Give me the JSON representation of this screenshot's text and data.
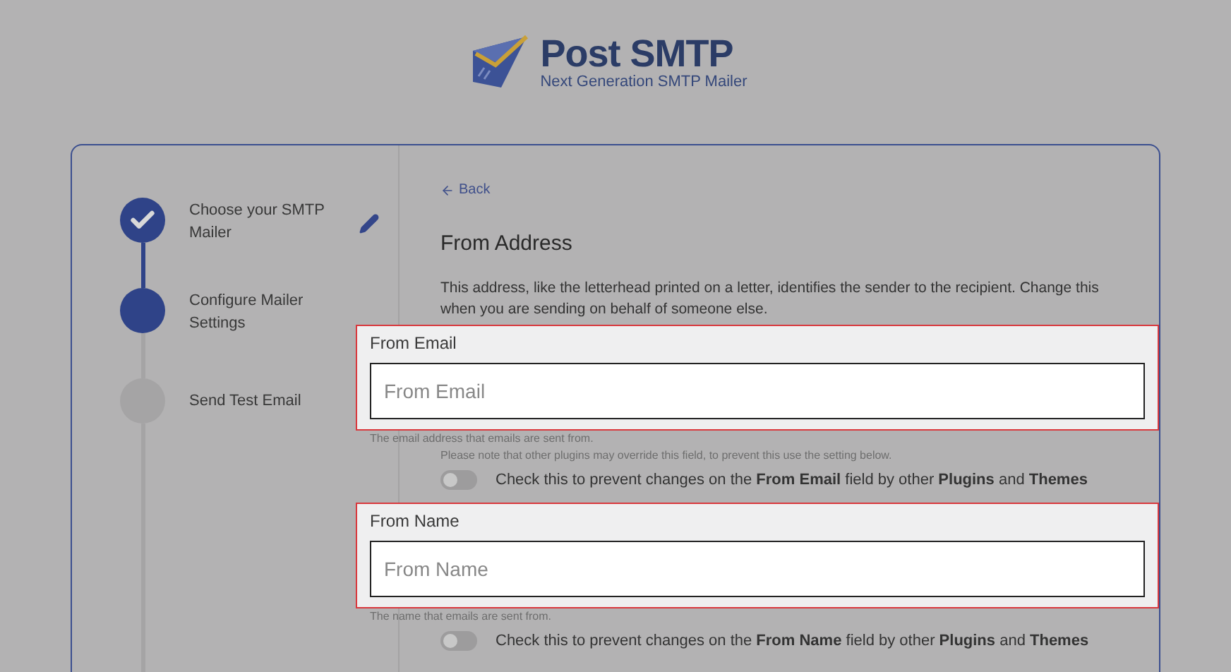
{
  "logo": {
    "name": "Post SMTP",
    "tagline": "Next Generation SMTP Mailer"
  },
  "steps": [
    {
      "label": "Choose your SMTP Mailer",
      "completed": true,
      "selected": false,
      "editable": true
    },
    {
      "label": "Configure Mailer Settings",
      "completed": false,
      "selected": true,
      "editable": false
    },
    {
      "label": "Send Test Email",
      "completed": false,
      "selected": false,
      "editable": false
    }
  ],
  "back_link": "Back",
  "section": {
    "title": "From Address",
    "description": "This address, like the letterhead printed on a letter, identifies the sender to the recipient. Change this when you are sending on behalf of someone else."
  },
  "fields": [
    {
      "label": "From Email",
      "placeholder": "From Email",
      "help": "The email address that emails are sent from.",
      "note": "Please note that other plugins may override this field, to prevent this use the setting below.",
      "toggle": {
        "label": "Check this to prevent changes on the **From Email** field by other **Plugins** and **Themes**",
        "on": false
      }
    },
    {
      "label": "From Name",
      "placeholder": "From Name",
      "help": "The name that emails are sent from.",
      "toggle": {
        "label": "Check this to prevent changes on the **From Name** field by other **Plugins** and **Themes**",
        "on": false
      }
    }
  ]
}
